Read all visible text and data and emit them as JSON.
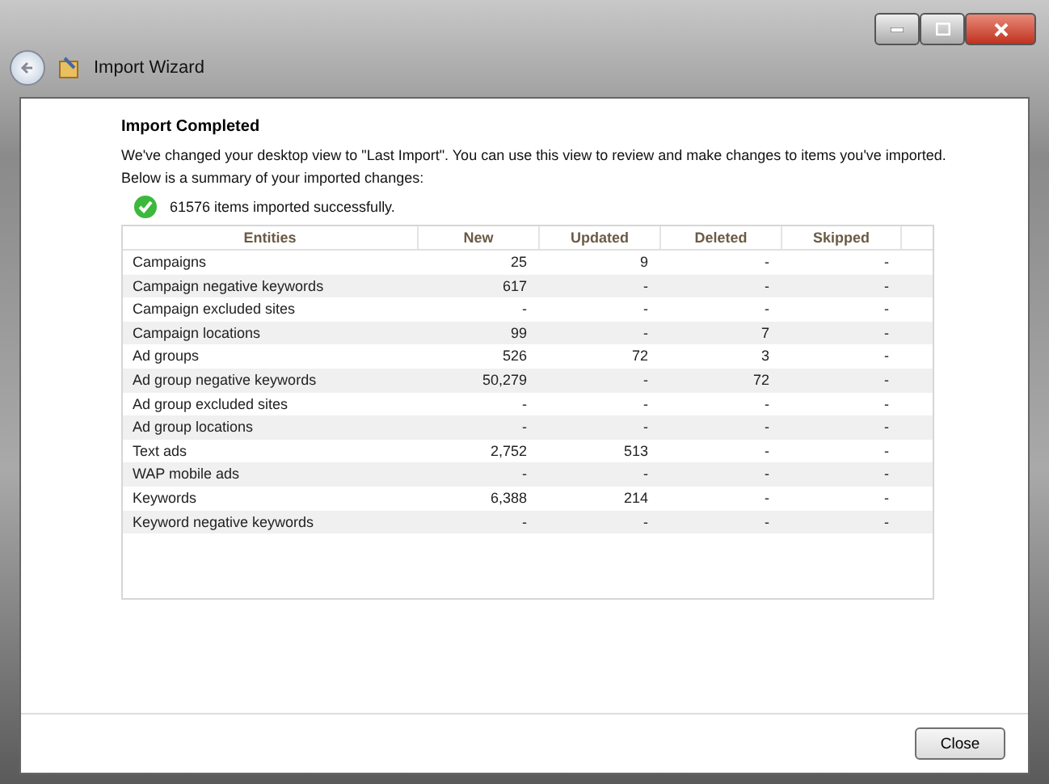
{
  "window": {
    "title": "Import Wizard"
  },
  "heading": "Import Completed",
  "description": "We've changed your desktop view to \"Last Import\". You can use this view to review and make changes to items you've imported.",
  "summary_intro": "Below is a summary of your imported changes:",
  "status": "61576 items imported successfully.",
  "table": {
    "columns": [
      "Entities",
      "New",
      "Updated",
      "Deleted",
      "Skipped"
    ],
    "rows": [
      [
        "Campaigns",
        "25",
        "9",
        "-",
        "-"
      ],
      [
        "Campaign negative keywords",
        "617",
        "-",
        "-",
        "-"
      ],
      [
        "Campaign excluded sites",
        "-",
        "-",
        "-",
        "-"
      ],
      [
        "Campaign locations",
        "99",
        "-",
        "7",
        "-"
      ],
      [
        "Ad groups",
        "526",
        "72",
        "3",
        "-"
      ],
      [
        "Ad group negative keywords",
        "50,279",
        "-",
        "72",
        "-"
      ],
      [
        "Ad group excluded sites",
        "-",
        "-",
        "-",
        "-"
      ],
      [
        "Ad group locations",
        "-",
        "-",
        "-",
        "-"
      ],
      [
        "Text ads",
        "2,752",
        "513",
        "-",
        "-"
      ],
      [
        "WAP mobile ads",
        "-",
        "-",
        "-",
        "-"
      ],
      [
        "Keywords",
        "6,388",
        "214",
        "-",
        "-"
      ],
      [
        "Keyword negative keywords",
        "-",
        "-",
        "-",
        "-"
      ]
    ]
  },
  "buttons": [
    "Close"
  ]
}
